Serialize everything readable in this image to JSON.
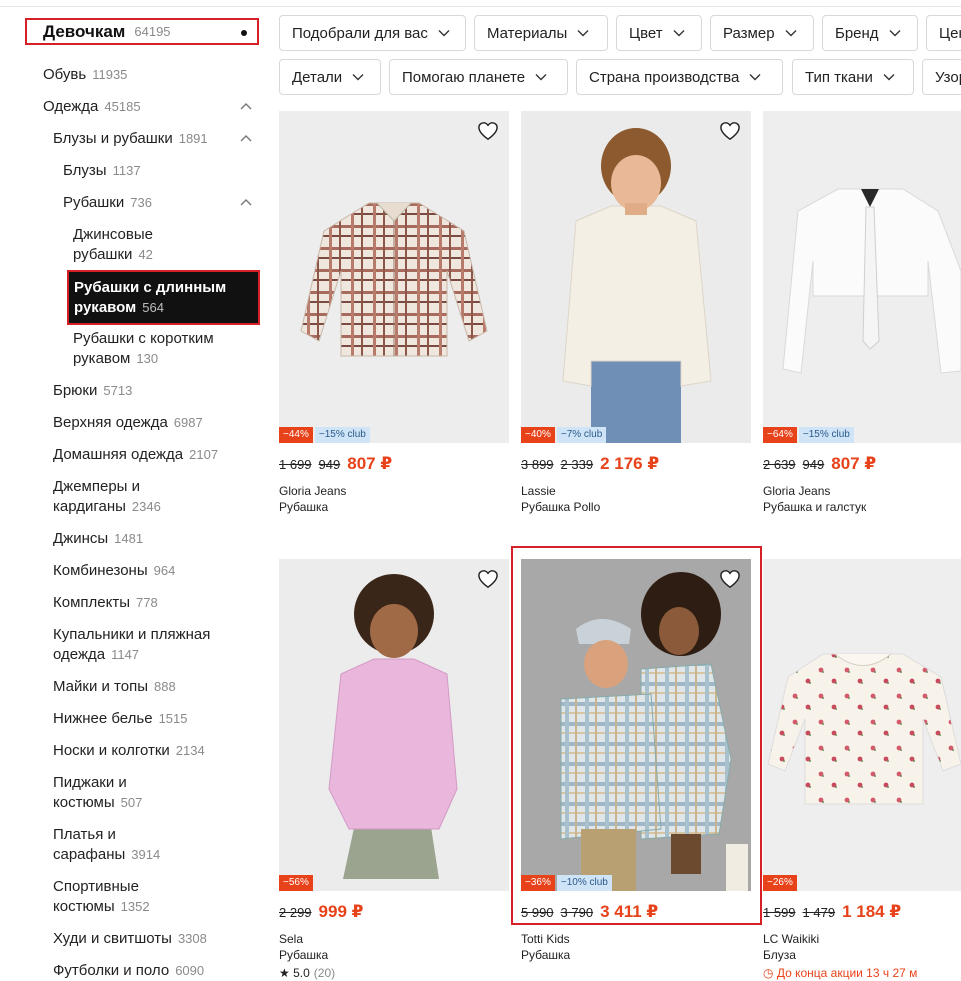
{
  "sidebar": {
    "root": {
      "label": "Девочкам",
      "count": "64195"
    },
    "items": [
      {
        "label": "Обувь",
        "count": "11935"
      },
      {
        "label": "Одежда",
        "count": "45185"
      },
      {
        "label": "Блузы и рубашки",
        "count": "1891"
      },
      {
        "label": "Блузы",
        "count": "1137"
      },
      {
        "label": "Рубашки",
        "count": "736"
      },
      {
        "label1": "Джинсовые",
        "label2": "рубашки",
        "count": "42"
      },
      {
        "label1": "Рубашки с длинным",
        "label2": "рукавом",
        "count": "564"
      },
      {
        "label1": "Рубашки с коротким",
        "label2": "рукавом",
        "count": "130"
      },
      {
        "label": "Брюки",
        "count": "5713"
      },
      {
        "label": "Верхняя одежда",
        "count": "6987"
      },
      {
        "label": "Домашняя одежда",
        "count": "2107"
      },
      {
        "label1": "Джемперы и",
        "label2": "кардиганы",
        "count": "2346"
      },
      {
        "label": "Джинсы",
        "count": "1481"
      },
      {
        "label": "Комбинезоны",
        "count": "964"
      },
      {
        "label": "Комплекты",
        "count": "778"
      },
      {
        "label1": "Купальники и пляжная",
        "label2": "одежда",
        "count": "1147"
      },
      {
        "label": "Майки и топы",
        "count": "888"
      },
      {
        "label": "Нижнее белье",
        "count": "1515"
      },
      {
        "label": "Носки и колготки",
        "count": "2134"
      },
      {
        "label1": "Пиджаки и",
        "label2": "костюмы",
        "count": "507"
      },
      {
        "label1": "Платья и",
        "label2": "сарафаны",
        "count": "3914"
      },
      {
        "label1": "Спортивные",
        "label2": "костюмы",
        "count": "1352"
      },
      {
        "label": "Худи и свитшоты",
        "count": "3308"
      },
      {
        "label": "Футболки и поло",
        "count": "6090"
      }
    ]
  },
  "filters": {
    "row1": [
      "Подобрали для вас",
      "Материалы",
      "Цвет",
      "Размер",
      "Бренд",
      "Цена"
    ],
    "row2": [
      "Детали",
      "Помогаю планете",
      "Страна производства",
      "Тип ткани",
      "Узор"
    ]
  },
  "products": [
    {
      "discount": "−44%",
      "club": "−15% club",
      "old1": "1 699",
      "old2": "949",
      "price": "807 ₽",
      "brand": "Gloria Jeans",
      "title": "Рубашка"
    },
    {
      "discount": "−40%",
      "club": "−7% club",
      "old1": "3 899",
      "old2": "2 339",
      "price": "2 176 ₽",
      "brand": "Lassie",
      "title": "Рубашка Pollo"
    },
    {
      "discount": "−64%",
      "club": "−15% club",
      "old1": "2 639",
      "old2": "949",
      "price": "807 ₽",
      "brand": "Gloria Jeans",
      "title": "Рубашка и галстук"
    },
    {
      "discount": "−56%",
      "club": "",
      "old1": "2 299",
      "old2": "",
      "price": "999 ₽",
      "brand": "Sela",
      "title": "Рубашка"
    },
    {
      "discount": "−36%",
      "club": "−10% club",
      "old1": "5 990",
      "old2": "3 790",
      "price": "3 411 ₽",
      "brand": "Totti Kids",
      "title": "Рубашка"
    },
    {
      "discount": "−26%",
      "club": "",
      "old1": "1 599",
      "old2": "1 479",
      "price": "1 184 ₽",
      "brand": "LC Waikiki",
      "title": "Блуза"
    }
  ],
  "rating": {
    "value": "★ 5.0",
    "count": "(20)"
  },
  "promo": "До конца акции 13 ч 27 м"
}
